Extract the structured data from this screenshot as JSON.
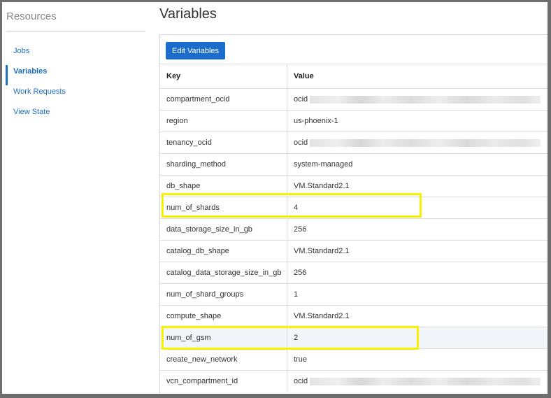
{
  "sidebar": {
    "title": "Resources",
    "items": [
      {
        "label": "Jobs",
        "active": false
      },
      {
        "label": "Variables",
        "active": true
      },
      {
        "label": "Work Requests",
        "active": false
      },
      {
        "label": "View State",
        "active": false
      }
    ]
  },
  "main": {
    "title": "Variables",
    "edit_button": "Edit Variables",
    "table": {
      "headers": [
        "Key",
        "Value"
      ],
      "rows": [
        {
          "key": "compartment_ocid",
          "value": "ocid",
          "redacted": true
        },
        {
          "key": "region",
          "value": "us-phoenix-1"
        },
        {
          "key": "tenancy_ocid",
          "value": "ocid",
          "redacted": true
        },
        {
          "key": "sharding_method",
          "value": "system-managed"
        },
        {
          "key": "db_shape",
          "value": "VM.Standard2.1"
        },
        {
          "key": "num_of_shards",
          "value": "4",
          "highlighted": true
        },
        {
          "key": "data_storage_size_in_gb",
          "value": "256"
        },
        {
          "key": "catalog_db_shape",
          "value": "VM.Standard2.1"
        },
        {
          "key": "catalog_data_storage_size_in_gb",
          "value": "256"
        },
        {
          "key": "num_of_shard_groups",
          "value": "1"
        },
        {
          "key": "compute_shape",
          "value": "VM.Standard2.1"
        },
        {
          "key": "num_of_gsm",
          "value": "2",
          "highlighted": true
        },
        {
          "key": "create_new_network",
          "value": "true"
        },
        {
          "key": "vcn_compartment_id",
          "value": "ocid",
          "redacted": true
        }
      ]
    }
  },
  "colors": {
    "accent": "#1a6dcc",
    "highlight_box": "#f7f000"
  }
}
